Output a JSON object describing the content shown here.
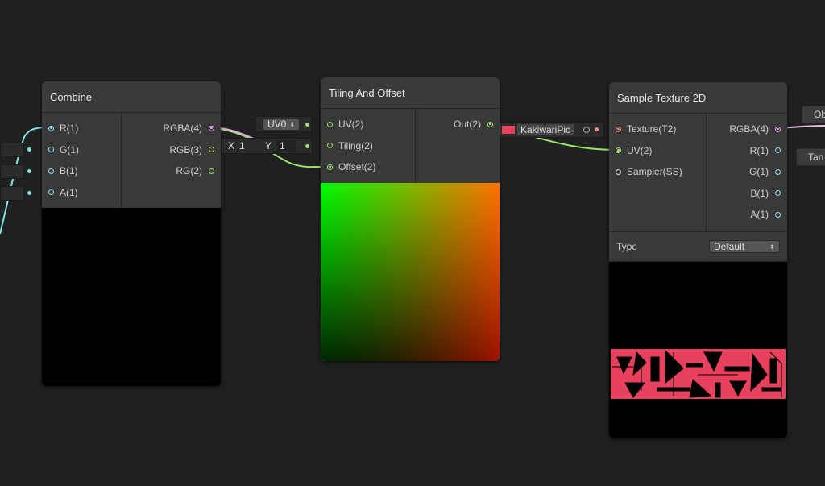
{
  "combine": {
    "title": "Combine",
    "inputs": [
      "R(1)",
      "G(1)",
      "B(1)",
      "A(1)"
    ],
    "outputs": [
      "RGBA(4)",
      "RGB(3)",
      "RG(2)"
    ]
  },
  "tiling": {
    "title": "Tiling And Offset",
    "inputs": [
      "UV(2)",
      "Tiling(2)",
      "Offset(2)"
    ],
    "outputs": [
      "Out(2)"
    ],
    "uv_dropdown": "UV0",
    "tiling_x_label": "X",
    "tiling_x_value": "1",
    "tiling_y_label": "Y",
    "tiling_y_value": "1"
  },
  "sample": {
    "title": "Sample Texture 2D",
    "inputs": [
      "Texture(T2)",
      "UV(2)",
      "Sampler(SS)"
    ],
    "outputs": [
      "RGBA(4)",
      "R(1)",
      "G(1)",
      "B(1)",
      "A(1)"
    ],
    "type_label": "Type",
    "type_value": "Default",
    "texture_field": "KakiwariPic"
  },
  "right_edge": {
    "top_button": "Ob",
    "bottom_button": "Tan"
  },
  "colors": {
    "background": "#202020",
    "node": "#393939",
    "port_float": "#84e4e7",
    "port_vec4": "#e8a0e8",
    "port_vec3": "#f0f08a",
    "port_vec2": "#9ce46a",
    "port_texture": "#f08a7a",
    "texture_pink": "#e8415e"
  }
}
